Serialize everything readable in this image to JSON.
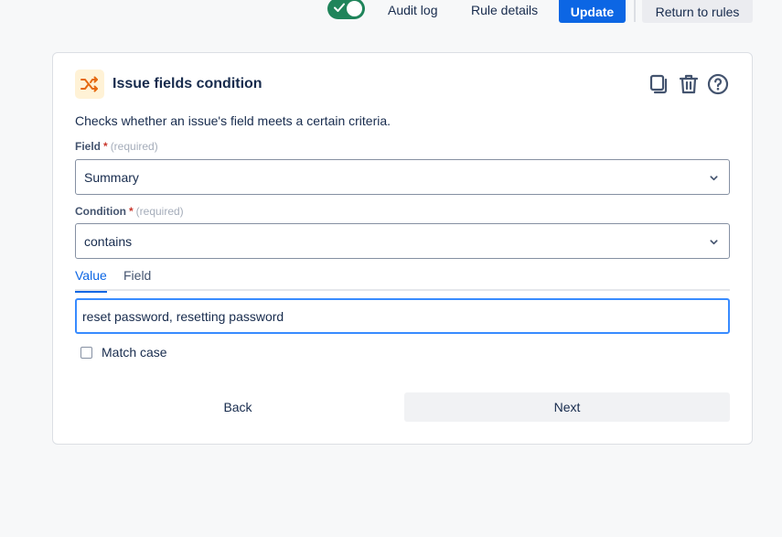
{
  "toolbar": {
    "rule_enabled": true,
    "audit_log_label": "Audit log",
    "rule_details_label": "Rule details",
    "update_label": "Update",
    "return_label": "Return to rules"
  },
  "card": {
    "icon": "shuffle-icon",
    "title": "Issue fields condition",
    "actions": [
      "copy-icon",
      "trash-icon",
      "help-icon"
    ],
    "description": "Checks whether an issue's field meets a certain criteria."
  },
  "field": {
    "label": "Field",
    "required_mark": "*",
    "hint": "(required)",
    "value": "Summary"
  },
  "condition": {
    "label": "Condition",
    "required_mark": "*",
    "hint": "(required)",
    "value": "contains"
  },
  "tabs": [
    {
      "label": "Value",
      "active": true
    },
    {
      "label": "Field",
      "active": false
    }
  ],
  "value_input": {
    "value": "reset password, resetting password"
  },
  "match_case": {
    "label": "Match case",
    "checked": false
  },
  "footer": {
    "back_label": "Back",
    "next_label": "Next"
  },
  "colors": {
    "primary": "#0c66e4",
    "toggle_on": "#1f845a",
    "icon_accent": "#e56910",
    "icon_bg": "#fff2d6"
  }
}
